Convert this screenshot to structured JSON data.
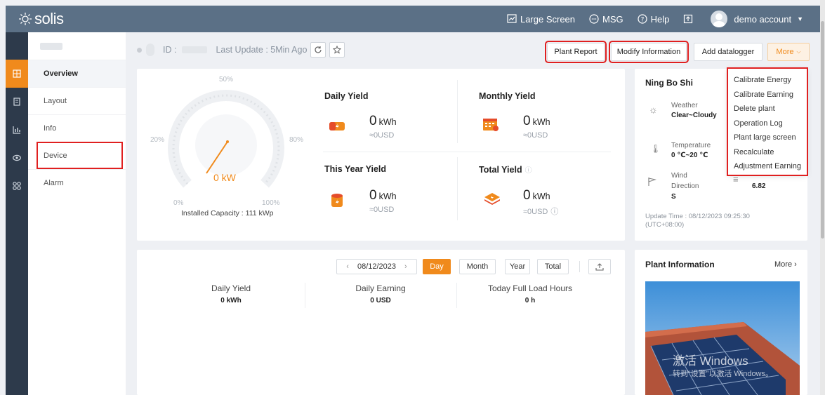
{
  "header": {
    "logo_text": "solis",
    "large_screen": "Large Screen",
    "msg": "MSG",
    "help": "Help",
    "account": "demo account"
  },
  "nav": {
    "items": [
      {
        "label": "Overview"
      },
      {
        "label": "Layout"
      },
      {
        "label": "Info"
      },
      {
        "label": "Device"
      },
      {
        "label": "Alarm"
      }
    ]
  },
  "status": {
    "id_label": "ID :",
    "last_update": "Last Update : 5Min Ago"
  },
  "actions": {
    "plant_report": "Plant Report",
    "modify_information": "Modify Information",
    "add_datalogger": "Add datalogger",
    "more": "More"
  },
  "more_menu": [
    "Calibrate Energy",
    "Calibrate Earning",
    "Delete plant",
    "Operation Log",
    "Plant large screen",
    "Recalculate",
    "Adjustment Earning"
  ],
  "gauge": {
    "value": "0 kW",
    "tick_0": "0%",
    "tick_20": "20%",
    "tick_50": "50%",
    "tick_80": "80%",
    "tick_100": "100%",
    "installed_capacity": "Installed Capacity : 111 kWp"
  },
  "yields": {
    "daily": {
      "label": "Daily Yield",
      "value": "0",
      "unit": "kWh",
      "usd": "≈0USD"
    },
    "monthly": {
      "label": "Monthly Yield",
      "value": "0",
      "unit": "kWh",
      "usd": "≈0USD"
    },
    "year": {
      "label": "This Year Yield",
      "value": "0",
      "unit": "kWh",
      "usd": "≈0USD"
    },
    "total": {
      "label": "Total Yield",
      "value": "0",
      "unit": "kWh",
      "usd": "≈0USD"
    }
  },
  "weather": {
    "city": "Ning Bo Shi",
    "weather_label": "Weather",
    "weather_value": "Clear~Cloudy",
    "temperature_label": "Temperature",
    "temperature_value": "0 ℃~20 ℃",
    "wind_label": "Wind",
    "direction_label": "Direction",
    "wind_dir_value": "S",
    "wind_speed_value": "6.82",
    "update_time": "Update Time : 08/12/2023 09:25:30",
    "timezone": "(UTC+08:00)"
  },
  "chart_bar": {
    "date": "08/12/2023",
    "day": "Day",
    "month": "Month",
    "year": "Year",
    "total": "Total"
  },
  "summary": {
    "daily_yield_label": "Daily Yield",
    "daily_yield_value": "0 kWh",
    "daily_earning_label": "Daily Earning",
    "daily_earning_value": "0 USD",
    "full_load_label": "Today Full Load Hours",
    "full_load_value": "0 h"
  },
  "plant_info": {
    "title": "Plant Information",
    "more": "More"
  },
  "watermark": {
    "line1": "激活 Windows",
    "line2": "转到“设置”以激活 Windows。"
  },
  "colors": {
    "accent": "#f08a1c",
    "topbar": "#5b7086",
    "rail": "#2d3a4b",
    "highlight": "#e02020"
  }
}
